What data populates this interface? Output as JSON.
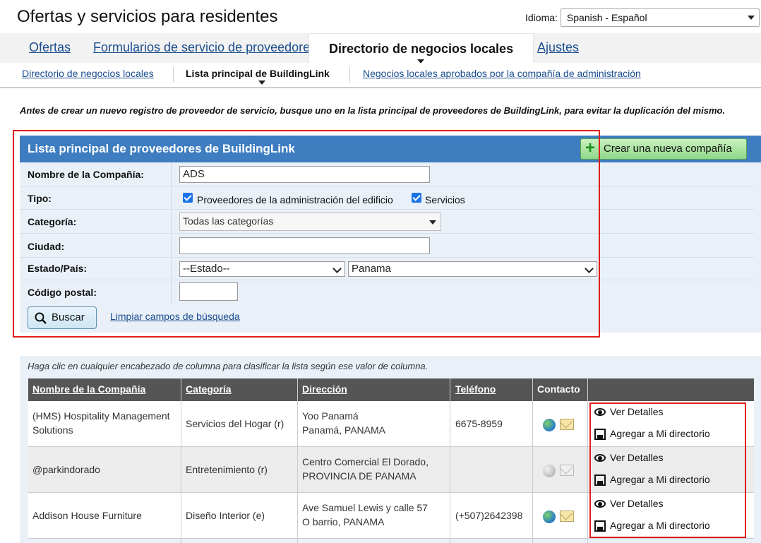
{
  "page": {
    "title": "Ofertas y servicios para residentes"
  },
  "language": {
    "label": "Idioma:",
    "value": "Spanish - Español"
  },
  "tabs": [
    {
      "label": "Ofertas"
    },
    {
      "label": "Formularios de servicio de proveedores"
    },
    {
      "label": "Directorio de negocios locales"
    },
    {
      "label": "Ajustes"
    }
  ],
  "subnav": [
    {
      "label": "Directorio de negocios locales"
    },
    {
      "label": "Lista principal de BuildingLink"
    },
    {
      "label": "Negocios locales aprobados por la compañía de administración"
    }
  ],
  "instructions": "Antes de crear un nuevo registro de proveedor de servicio, busque uno en la lista principal de proveedores de BuildingLink, para evitar la duplicación del mismo.",
  "search": {
    "title": "Lista principal de proveedores de BuildingLink",
    "new_company_label": "Crear una nueva compañía",
    "company_label": "Nombre de la Compañía:",
    "company_value": "ADS",
    "type_label": "Tipo:",
    "type_option1": "Proveedores de la administración del edificio",
    "type_option2": "Servicios",
    "category_label": "Categoría:",
    "category_value": "Todas las categorías",
    "city_label": "Ciudad:",
    "city_value": "",
    "state_country_label": "Estado/País:",
    "state_value": "--Estado--",
    "country_value": "Panama",
    "zip_label": "Código postal:",
    "zip_value": "",
    "search_button": "Buscar",
    "clear_link": "Limpiar campos de búsqueda"
  },
  "results": {
    "hint": "Haga clic en cualquier encabezado de columna para clasificar la lista según ese valor de columna.",
    "columns": {
      "company": "Nombre de la Compañía",
      "category": "Categoría",
      "address": "Dirección",
      "phone": "Teléfono",
      "contact": "Contacto"
    },
    "view_details": "Ver Detalles",
    "add_directory": "Agregar a Mi directorio",
    "rows": [
      {
        "company": "(HMS) Hospitality Management Solutions",
        "category": "Servicios del Hogar (r)",
        "address1": "Yoo Panamá",
        "address2": "Panamá, PANAMA",
        "phone": "6675-8959"
      },
      {
        "company": "@parkindorado",
        "category": "Entretenimiento (r)",
        "address1": "Centro Comercial El Dorado,",
        "address2": "PROVINCIA DE PANAMA",
        "phone": ""
      },
      {
        "company": "Addison House Furniture",
        "category": "Diseño Interior (e)",
        "address1": "Ave Samuel Lewis y calle 57",
        "address2": "O barrio, PANAMA",
        "phone": "(+507)2642398"
      }
    ]
  },
  "colors": {
    "header_blue": "#3d7dc0",
    "panel_bg": "#e9f0f8",
    "highlight_red": "#e01e1e",
    "table_header": "#555555"
  }
}
